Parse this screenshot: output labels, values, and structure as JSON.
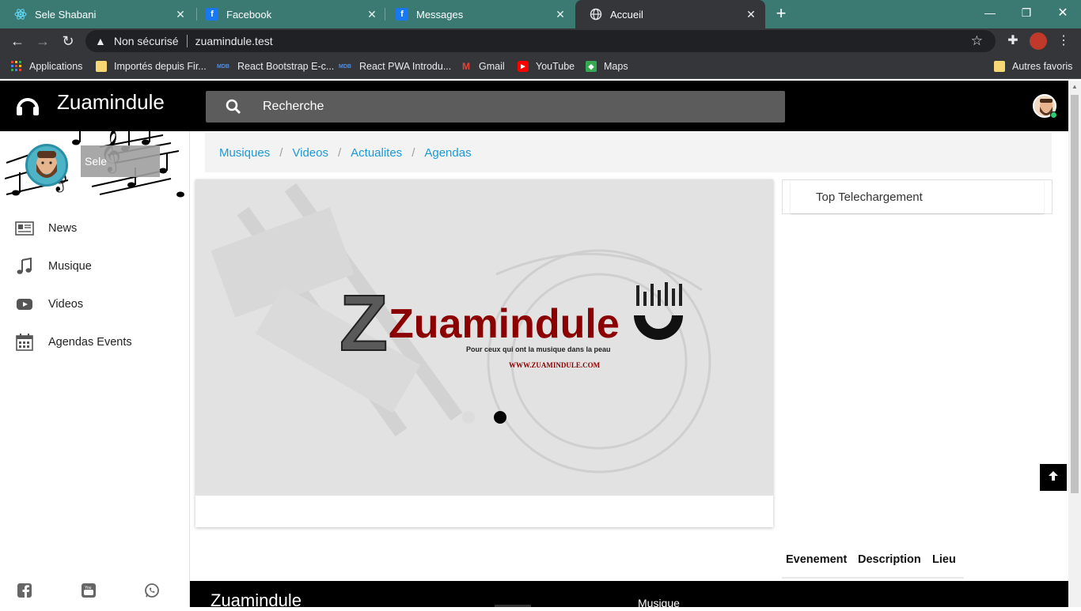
{
  "browser": {
    "tabs": [
      {
        "title": "Sele Shabani",
        "favicon": "react-icon"
      },
      {
        "title": "Facebook",
        "favicon": "facebook-icon"
      },
      {
        "title": "Messages",
        "favicon": "facebook-icon"
      },
      {
        "title": "Accueil",
        "favicon": "globe-icon",
        "active": true
      }
    ],
    "address": {
      "security_label": "Non sécurisé",
      "url": "zuamindule.test"
    },
    "bookmarks": [
      {
        "label": "Applications",
        "icon": "apps-grid-icon"
      },
      {
        "label": "Importés depuis Fir...",
        "icon": "folder-icon"
      },
      {
        "label": "React Bootstrap E-c...",
        "icon": "mdb-icon"
      },
      {
        "label": "React PWA Introdu...",
        "icon": "mdb-icon"
      },
      {
        "label": "Gmail",
        "icon": "gmail-icon"
      },
      {
        "label": "YouTube",
        "icon": "youtube-icon"
      },
      {
        "label": "Maps",
        "icon": "maps-icon"
      }
    ],
    "other_bookmarks": "Autres favoris"
  },
  "header": {
    "brand": "Zuamindule",
    "search_placeholder": "Recherche"
  },
  "sidebar": {
    "user_name": "Sele",
    "items": [
      {
        "label": "News",
        "icon": "newspaper-icon"
      },
      {
        "label": "Musique",
        "icon": "music-note-icon"
      },
      {
        "label": "Videos",
        "icon": "youtube-play-icon"
      },
      {
        "label": "Agendas Events",
        "icon": "calendar-icon"
      }
    ],
    "social": [
      "facebook-icon",
      "youtube-icon",
      "whatsapp-icon"
    ]
  },
  "breadcrumb": [
    "Musiques",
    "Videos",
    "Actualites",
    "Agendas"
  ],
  "carousel": {
    "logo_text": "Zuamindule",
    "tagline": "Pour ceux qui ont la musique dans la peau",
    "website": "WWW.ZUAMINDULE.COM",
    "active_slide": 2,
    "slide_count": 2
  },
  "top_downloads": {
    "title": "Top Telechargement"
  },
  "events_table": {
    "columns": [
      "Evenement",
      "Description",
      "Lieu"
    ]
  },
  "footer": {
    "brand": "Zuamindule",
    "music_heading": "Musique"
  },
  "colors": {
    "tabbar": "#3a7a72",
    "chrome": "#35363a",
    "header": "#000000",
    "link": "#1a9ad6",
    "logo_red": "#8b0000"
  }
}
